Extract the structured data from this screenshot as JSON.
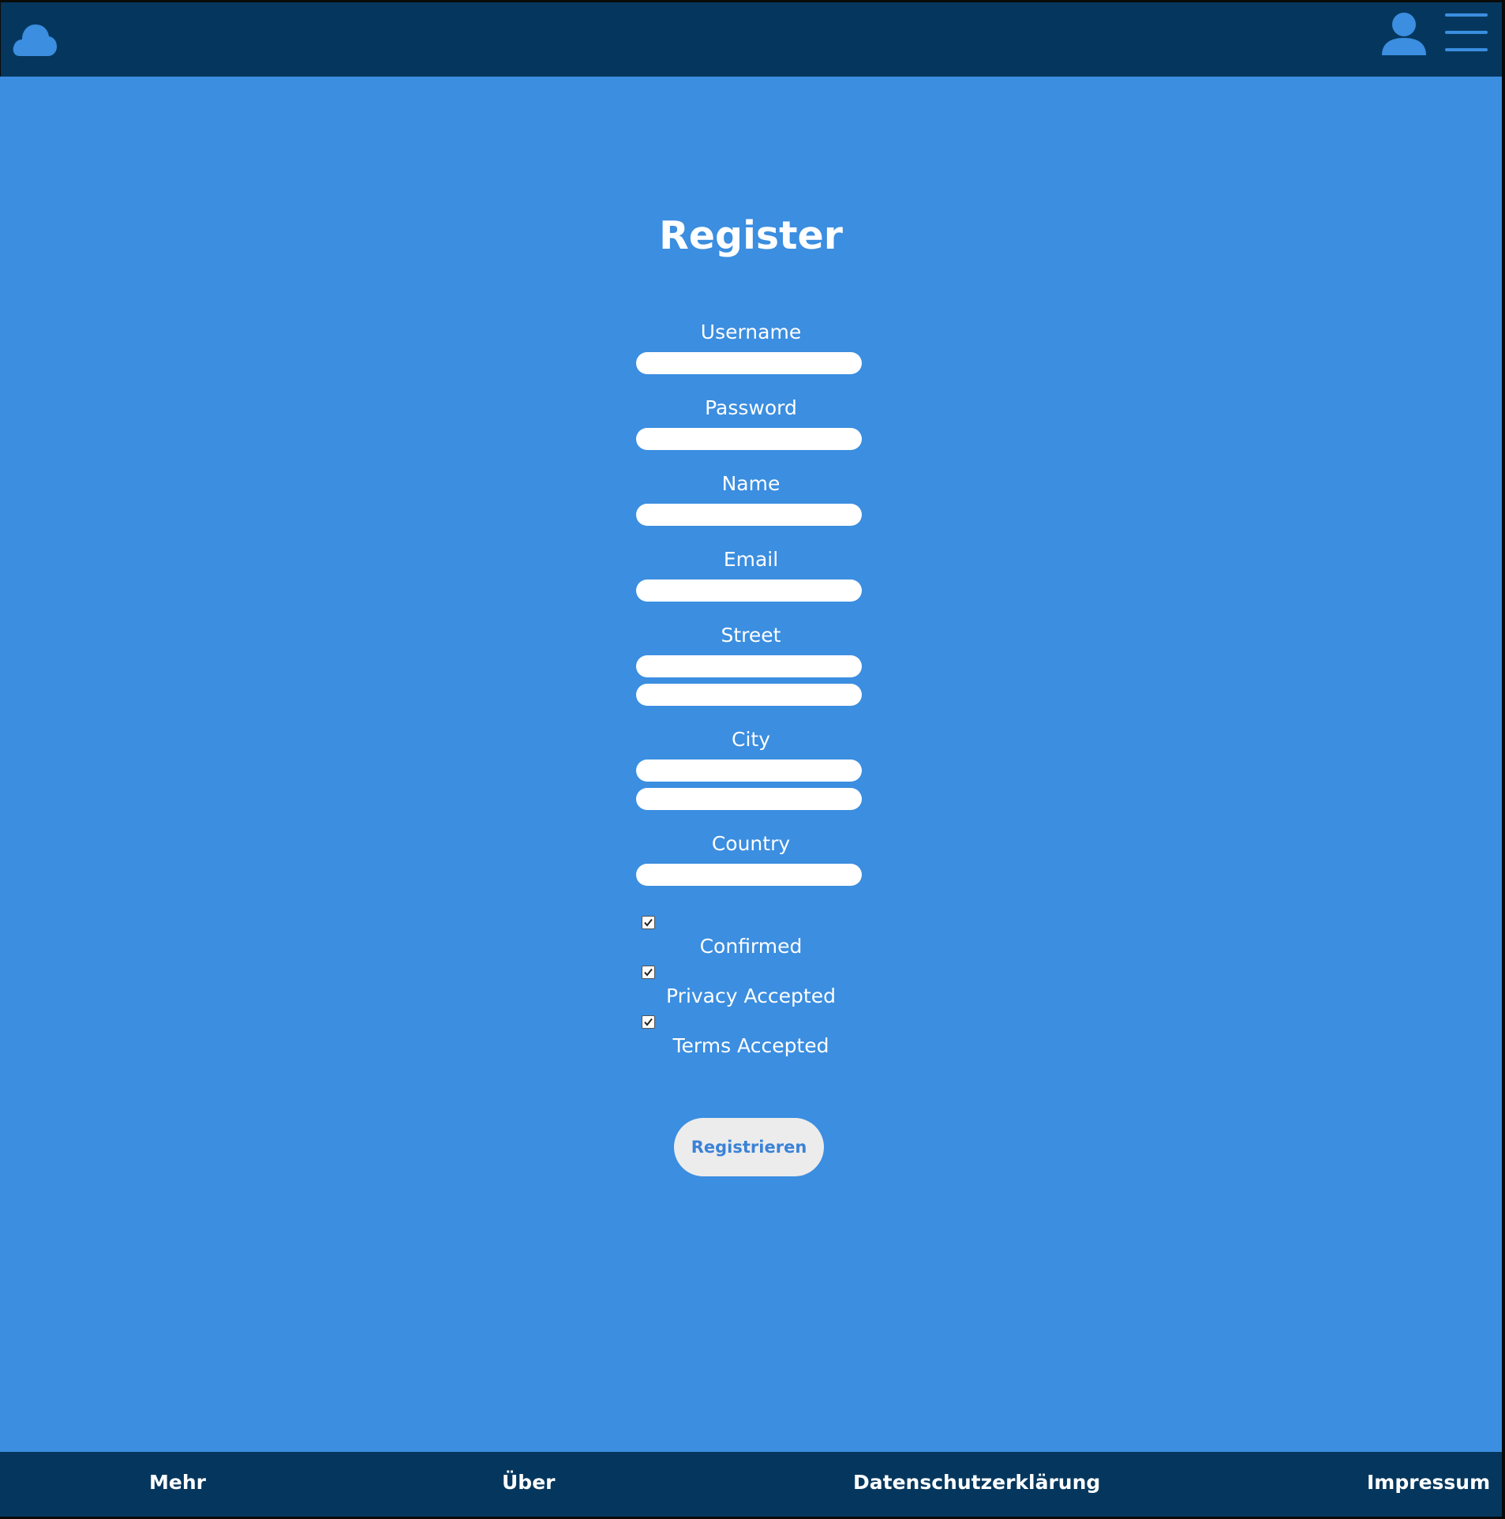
{
  "header": {
    "logo_icon": "cloud-icon",
    "user_icon": "user-icon",
    "menu_icon": "hamburger-menu-icon"
  },
  "page": {
    "title": "Register"
  },
  "form": {
    "username_label": "Username",
    "username_value": "",
    "password_label": "Password",
    "password_value": "",
    "name_label": "Name",
    "name_value": "",
    "email_label": "Email",
    "email_value": "",
    "street_label": "Street",
    "street_line1_value": "",
    "street_line2_value": "",
    "city_label": "City",
    "city_line1_value": "",
    "city_line2_value": "",
    "country_label": "Country",
    "country_value": "",
    "checkboxes": [
      {
        "label": "Confirmed",
        "checked": true
      },
      {
        "label": "Privacy Accepted",
        "checked": true
      },
      {
        "label": "Terms Accepted",
        "checked": true
      }
    ],
    "submit_label": "Registrieren"
  },
  "footer": {
    "links": [
      "Mehr",
      "Über",
      "Datenschutzerklärung",
      "Impressum"
    ]
  },
  "colors": {
    "background": "#3b8ee0",
    "navbar": "#05375e",
    "button_text": "#3b82d6",
    "button_bg": "#ececec"
  }
}
